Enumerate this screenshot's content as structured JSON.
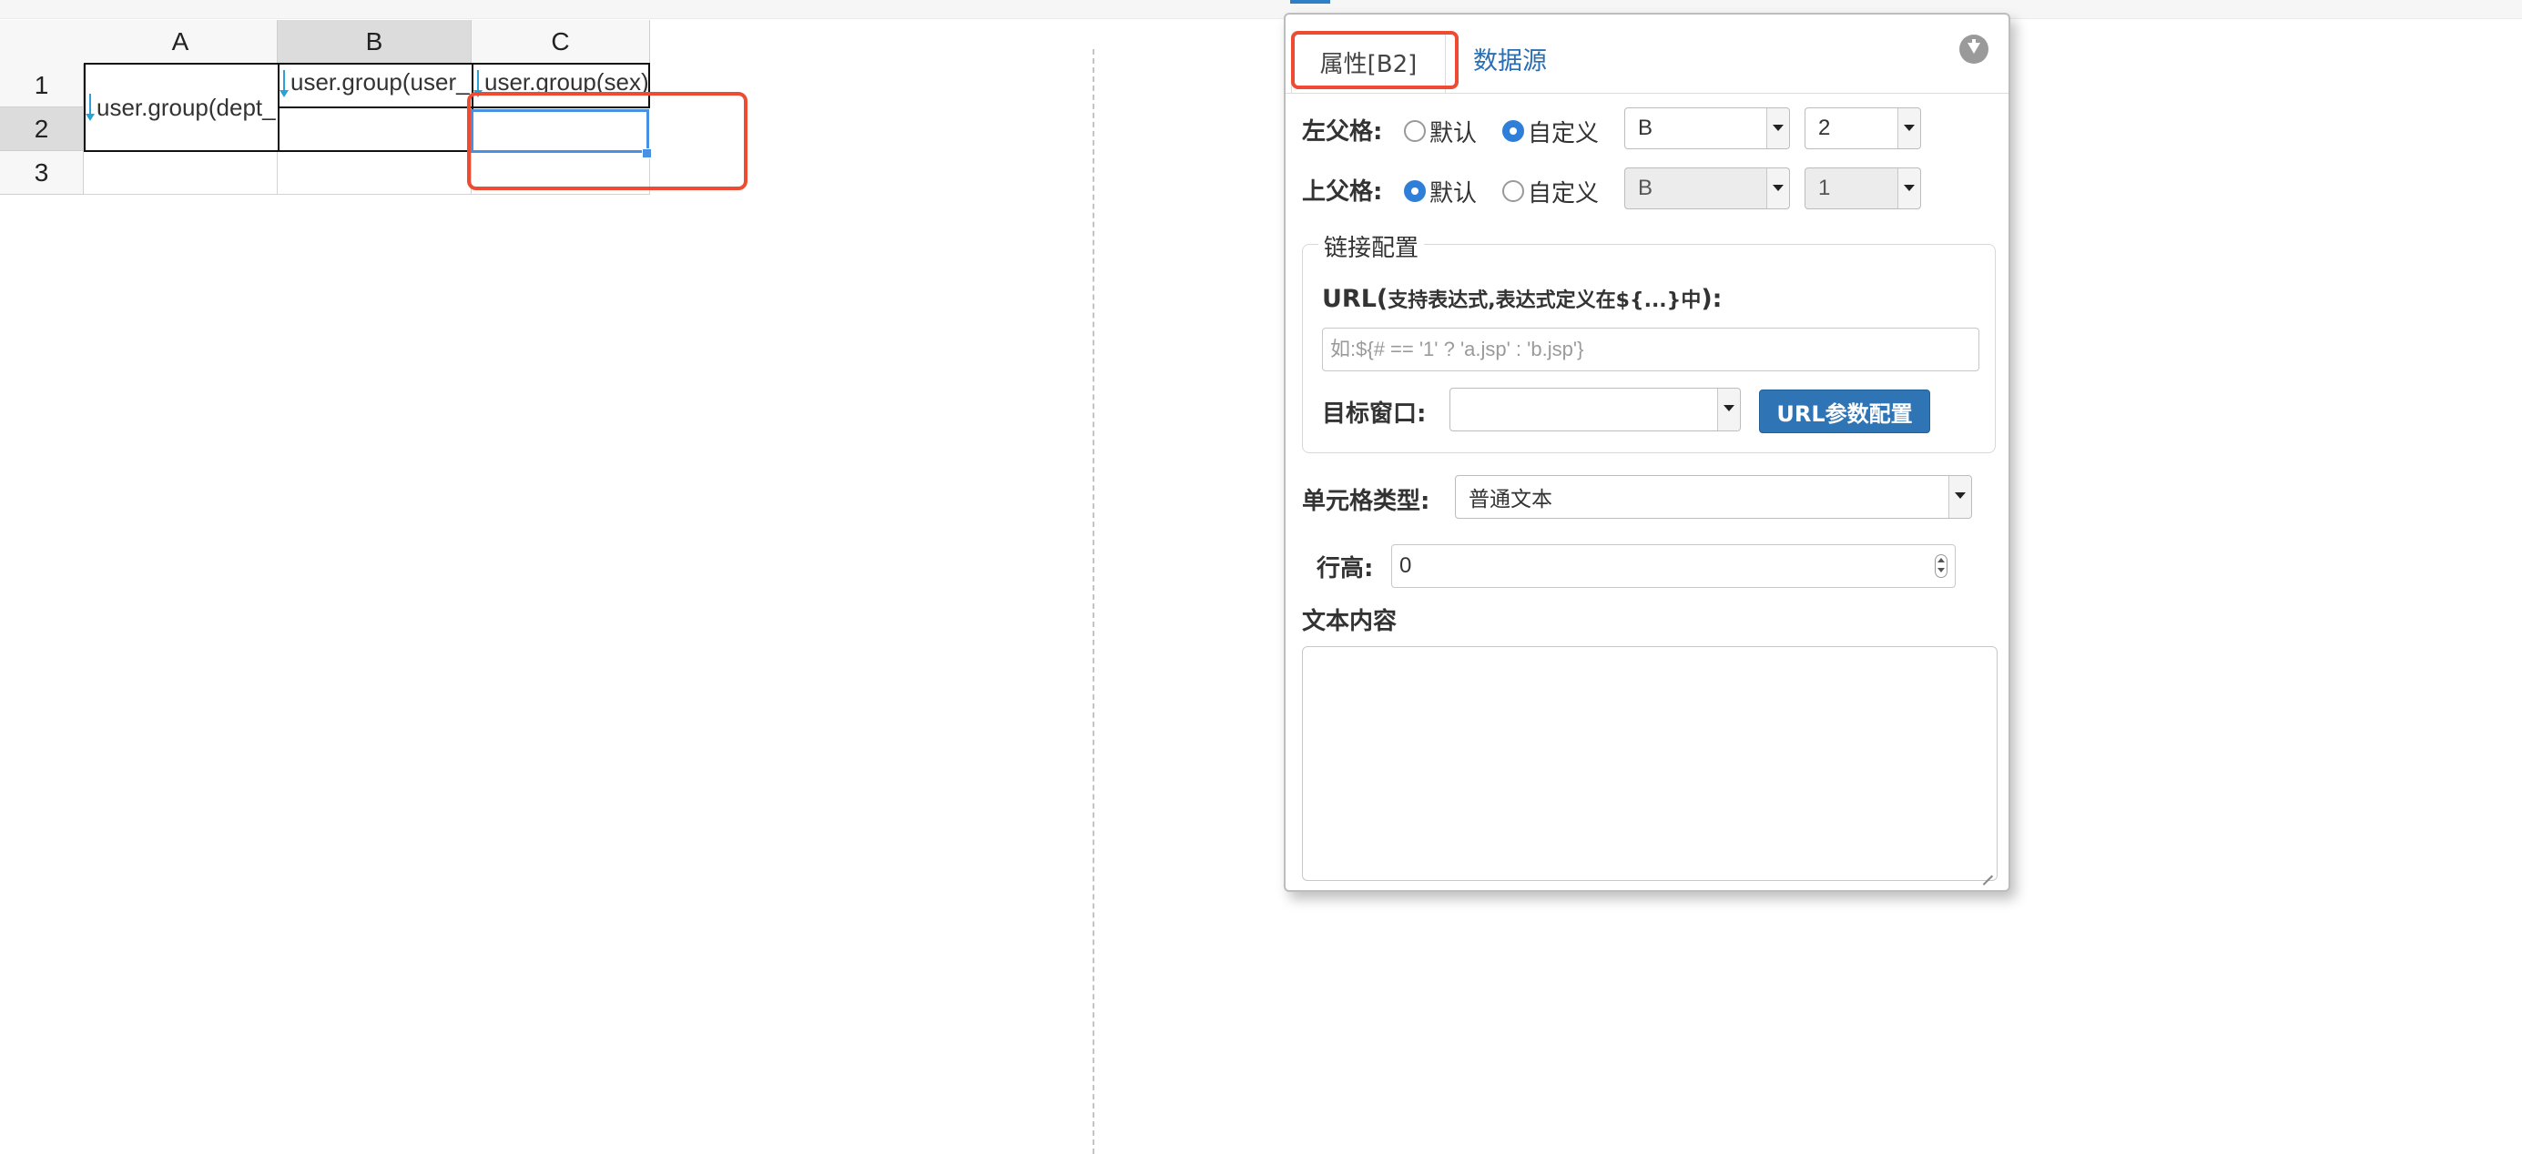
{
  "sheet": {
    "columns": [
      "A",
      "B",
      "C"
    ],
    "rows": [
      "1",
      "2",
      "3"
    ],
    "cells": {
      "A1": "user.group(dept_",
      "B1": "user.group(user_",
      "C1": "user.group(sex)"
    },
    "selected_column": "B",
    "selected_row": "2"
  },
  "panel": {
    "tabs": [
      "属性[B2]",
      "数据源"
    ],
    "left_parent": {
      "label": "左父格:",
      "default_label": "默认",
      "custom_label": "自定义",
      "selected": "custom",
      "column_value": "B",
      "row_value": "2"
    },
    "top_parent": {
      "label": "上父格:",
      "default_label": "默认",
      "custom_label": "自定义",
      "selected": "default",
      "column_value": "B",
      "row_value": "1"
    },
    "link_config": {
      "legend": "链接配置",
      "url_label_main": "URL(",
      "url_label_hint": "支持表达式,表达式定义在${...}中",
      "url_label_end": "):",
      "url_placeholder": "如:${# == '1' ? 'a.jsp' : 'b.jsp'}",
      "url_value": "",
      "target_label": "目标窗口:",
      "target_value": "",
      "param_button": "URL参数配置"
    },
    "cell_type": {
      "label": "单元格类型:",
      "value": "普通文本"
    },
    "row_height": {
      "label": "行高:",
      "value": "0"
    },
    "text_content": {
      "label": "文本内容",
      "value": ""
    }
  },
  "colors": {
    "accent": "#2f74b5",
    "highlight": "#ee4b33",
    "selection": "#4a90e2",
    "arrow": "#2aa2d6"
  }
}
